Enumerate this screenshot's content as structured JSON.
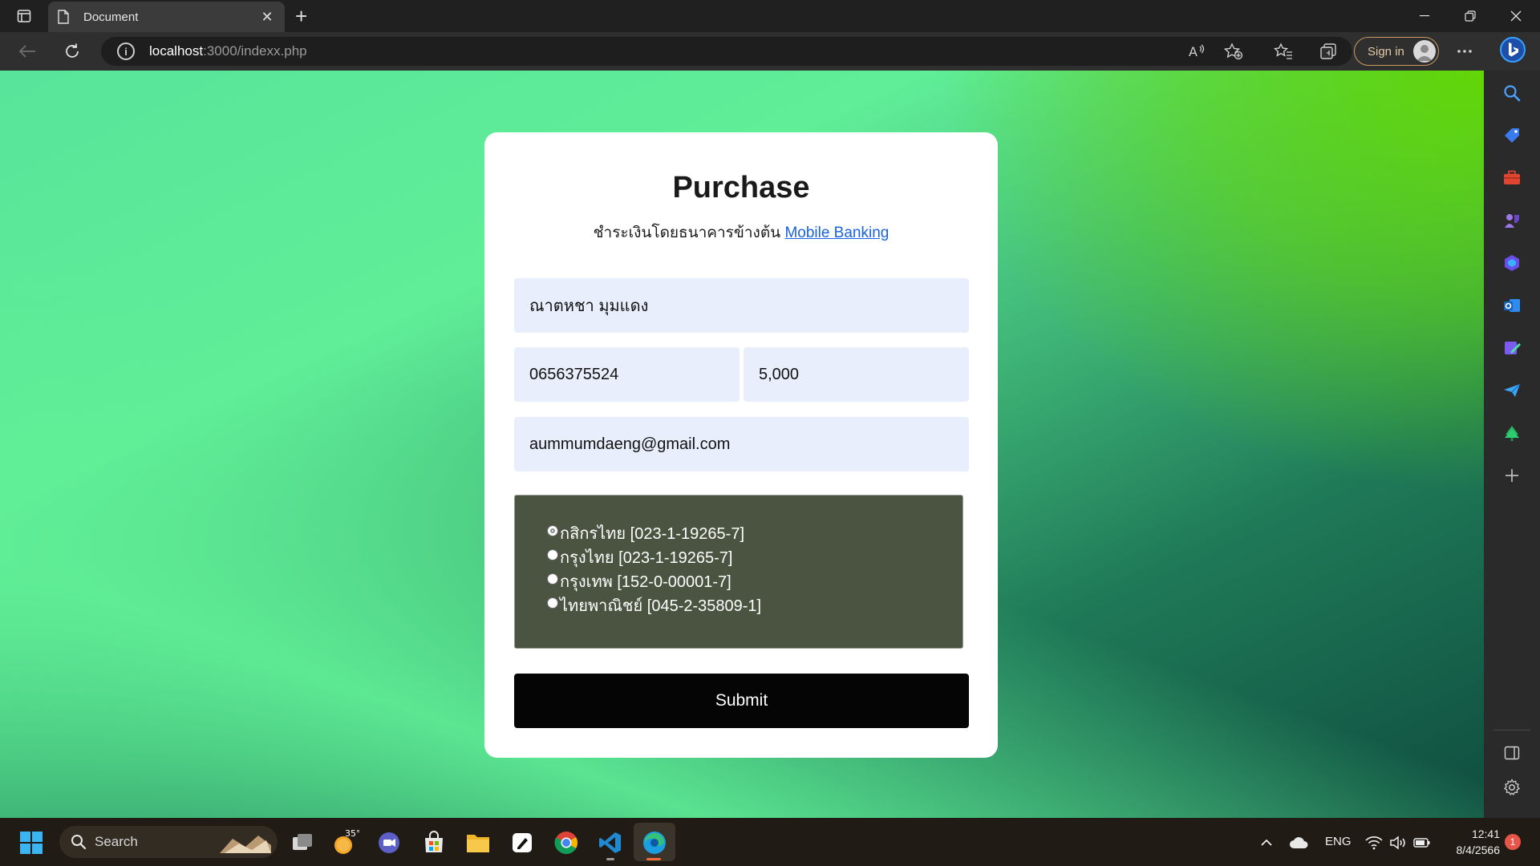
{
  "browser": {
    "tab_title": "Document",
    "url_host": "localhost",
    "url_rest": ":3000/indexx.php",
    "signin_label": "Sign in"
  },
  "page": {
    "title": "Purchase",
    "subtitle_text": "ชำระเงินโดยธนาคารข้างต้น ",
    "subtitle_link": "Mobile Banking",
    "form": {
      "name": "ณาตหชา มุมแดง",
      "phone": "0656375524",
      "amount": "5,000",
      "email": "aummumdaeng@gmail.com",
      "banks": [
        "กสิกรไทย [023-1-19265-7]",
        "กรุงไทย [023-1-19265-7]",
        "กรุงเทพ [152-0-00001-7]",
        "ไทยพาณิชย์ [045-2-35809-1]"
      ],
      "submit_label": "Submit"
    },
    "colors": {
      "card_bg": "#ffffff",
      "input_bg": "#e8eefc",
      "bank_box_bg": "#4a5440",
      "submit_bg": "#050505",
      "link": "#1a62e0",
      "background_green": "#60ee98",
      "background_lime": "#64d700"
    }
  },
  "taskbar": {
    "search_label": "Search",
    "weather_temp": "35°",
    "language": "ENG",
    "time": "12:41",
    "date": "8/4/2566",
    "notification_count": "1"
  }
}
